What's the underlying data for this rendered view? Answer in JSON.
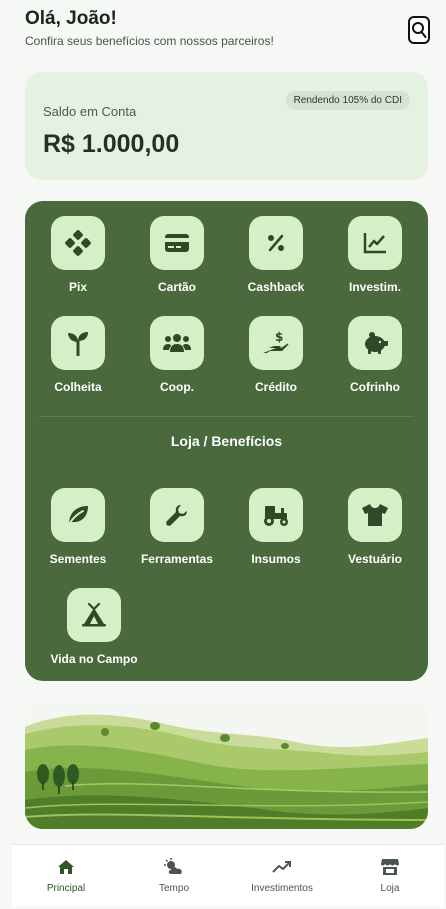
{
  "header": {
    "greeting": "Olá, João!",
    "subtitle": "Confira seus benefícios com nossos parceiros!"
  },
  "balance": {
    "label": "Saldo em Conta",
    "value": "R$ 1.000,00",
    "badge": "Rendendo 105% do CDI"
  },
  "services": {
    "items": [
      {
        "label": "Pix",
        "icon": "pix-icon"
      },
      {
        "label": "Cartão",
        "icon": "credit-card-icon"
      },
      {
        "label": "Cashback",
        "icon": "percent-icon"
      },
      {
        "label": "Investim.",
        "icon": "chart-line-icon"
      },
      {
        "label": "Colheita",
        "icon": "seedling-icon"
      },
      {
        "label": "Coop.",
        "icon": "users-icon"
      },
      {
        "label": "Crédito",
        "icon": "hand-dollar-icon"
      },
      {
        "label": "Cofrinho",
        "icon": "piggy-bank-icon"
      }
    ],
    "store_title": "Loja / Benefícios",
    "store_items": [
      {
        "label": "Sementes",
        "icon": "leaf-icon"
      },
      {
        "label": "Ferramentas",
        "icon": "wrench-icon"
      },
      {
        "label": "Insumos",
        "icon": "tractor-icon"
      },
      {
        "label": "Vestuário",
        "icon": "shirt-icon"
      },
      {
        "label": "Vida no Campo",
        "icon": "campground-icon"
      }
    ]
  },
  "nav": {
    "items": [
      {
        "label": "Principal",
        "icon": "home-icon"
      },
      {
        "label": "Tempo",
        "icon": "weather-icon"
      },
      {
        "label": "Investimentos",
        "icon": "trend-up-icon"
      },
      {
        "label": "Loja",
        "icon": "store-icon"
      }
    ],
    "active_color": "#2f5527"
  },
  "colors": {
    "primary": "#4a6a3d",
    "tile": "#d5f0c6",
    "card": "#e5f2e2"
  }
}
